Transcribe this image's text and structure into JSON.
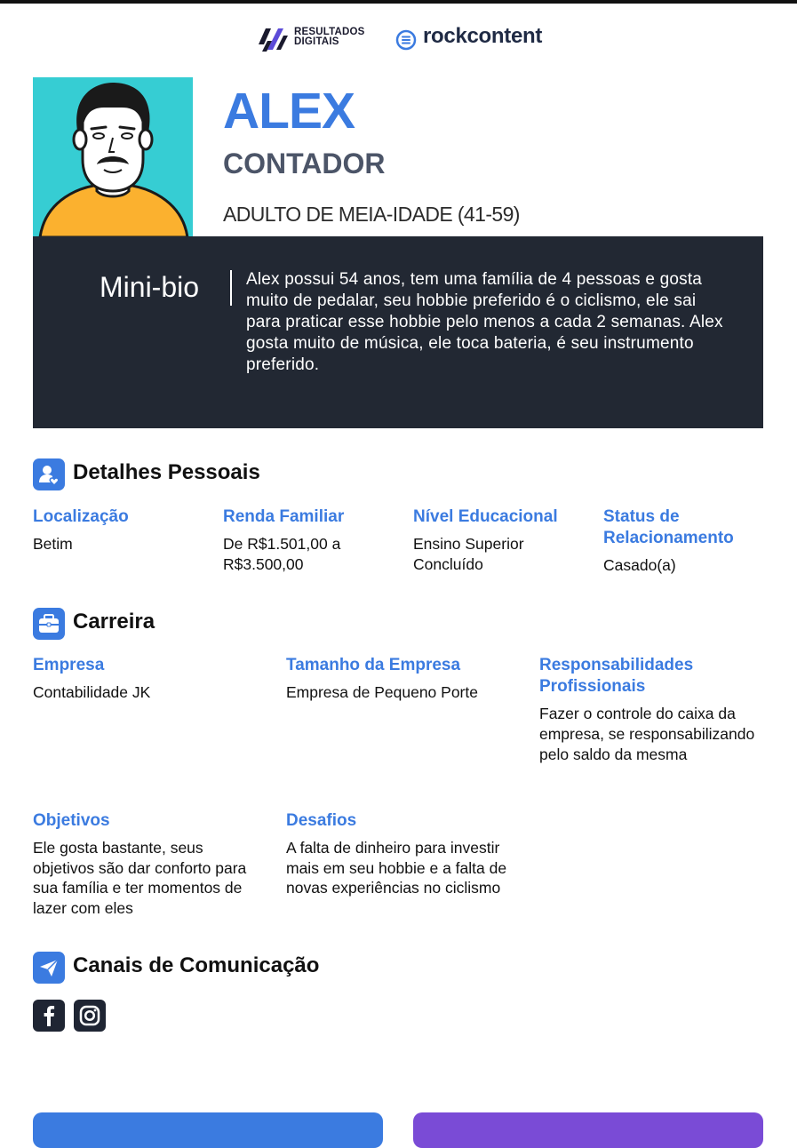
{
  "logos": {
    "rd_line1": "RESULTADOS",
    "rd_line2": "DIGITAIS",
    "rc_text": "rockcontent"
  },
  "persona": {
    "name": "ALEX",
    "role": "CONTADOR",
    "age_group": "ADULTO DE MEIA-IDADE (41-59)",
    "mini_bio_label": "Mini-bio",
    "mini_bio": "Alex possui 54 anos, tem uma família de 4 pessoas e gosta muito de pedalar, seu hobbie preferido é o ciclismo, ele sai para praticar esse hobbie pelo menos a cada 2 semanas. Alex gosta muito de música, ele toca bateria, é seu instrumento preferido."
  },
  "personal": {
    "title": "Detalhes Pessoais",
    "location_label": "Localização",
    "location": "Betim",
    "income_label": "Renda Familiar",
    "income": "De R$1.501,00 a R$3.500,00",
    "education_label": "Nível Educacional",
    "education": "Ensino Superior Concluído",
    "relationship_label": "Status de Relacionamento",
    "relationship": "Casado(a)"
  },
  "career": {
    "title": "Carreira",
    "company_label": "Empresa",
    "company": "Contabilidade JK",
    "size_label": "Tamanho da Empresa",
    "size": "Empresa de Pequeno Porte",
    "resp_label": "Responsabilidades Profissionais",
    "resp": "Fazer o controle do caixa da empresa, se responsabilizando pelo saldo da mesma",
    "goals_label": "Objetivos",
    "goals": "Ele gosta bastante, seus objetivos são dar conforto para sua família e ter momentos de lazer com eles",
    "challenges_label": "Desafios",
    "challenges": "A falta de dinheiro para investir mais em seu hobbie e a falta de novas experiências no ciclismo"
  },
  "channels": {
    "title": "Canais de Comunicação",
    "items": [
      "facebook-icon",
      "instagram-icon"
    ]
  },
  "colors": {
    "accent": "#3b7be0",
    "avatar_bg": "#36cdd3",
    "bio_bg": "#222833",
    "purple": "#7a4bd6"
  }
}
